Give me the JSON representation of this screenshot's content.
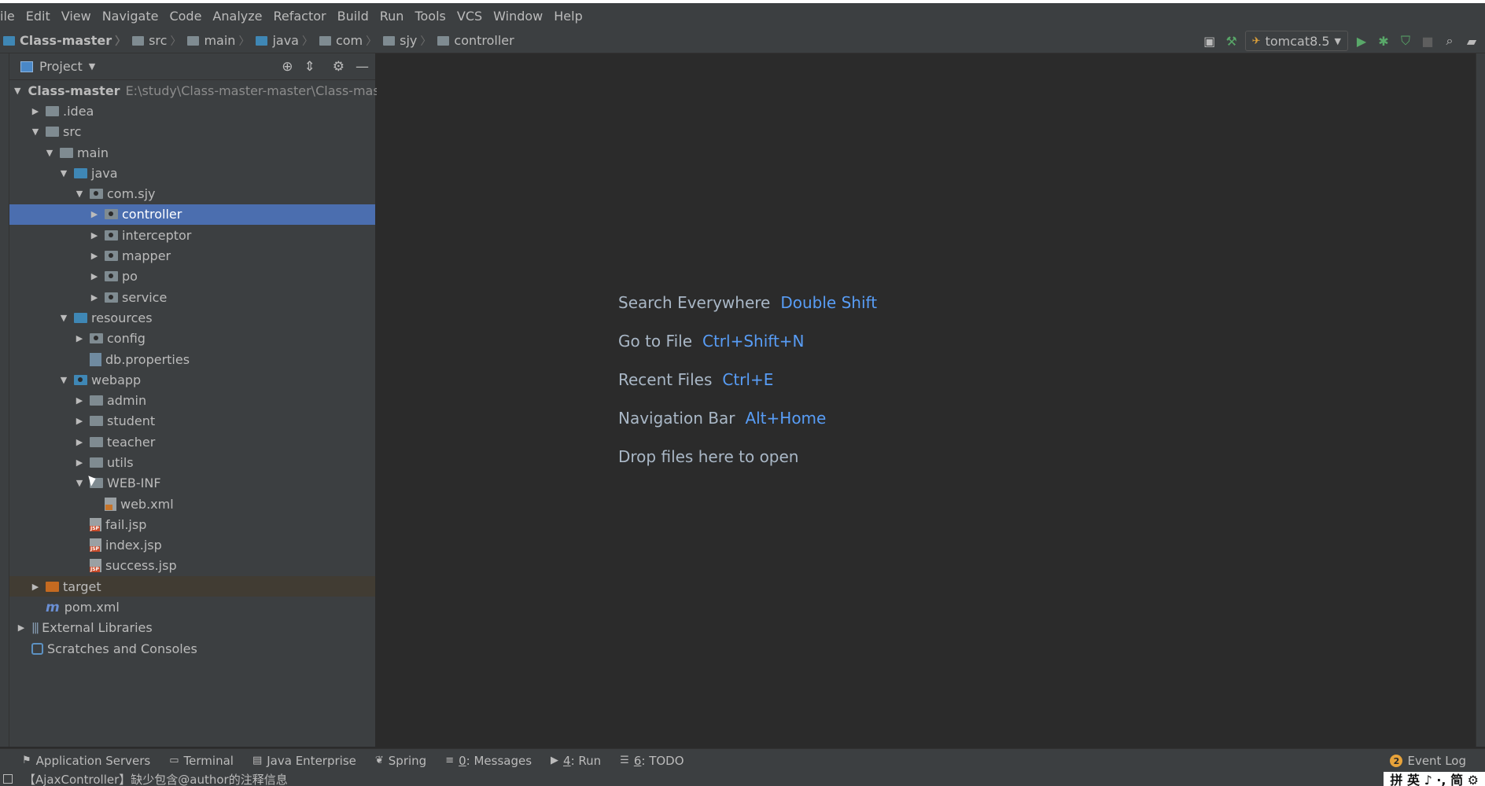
{
  "menu": [
    "ile",
    "Edit",
    "View",
    "Navigate",
    "Code",
    "Analyze",
    "Refactor",
    "Build",
    "Run",
    "Tools",
    "VCS",
    "Window",
    "Help"
  ],
  "breadcrumb": [
    "Class-master",
    "src",
    "main",
    "java",
    "com",
    "sjy",
    "controller"
  ],
  "toolbar": {
    "run_config": "tomcat8.5"
  },
  "project_panel": {
    "title": "Project",
    "tree": [
      {
        "label": "Class-master",
        "path": "E:\\study\\Class-master-master\\Class-master",
        "arrow": "▼",
        "icon": "module-folder",
        "depth": 0
      },
      {
        "label": ".idea",
        "arrow": "▶",
        "icon": "folder",
        "depth": 1
      },
      {
        "label": "src",
        "arrow": "▼",
        "icon": "folder",
        "depth": 1
      },
      {
        "label": "main",
        "arrow": "▼",
        "icon": "folder",
        "depth": 2
      },
      {
        "label": "java",
        "arrow": "▼",
        "icon": "source-folder",
        "depth": 3
      },
      {
        "label": "com.sjy",
        "arrow": "▼",
        "icon": "package-folder",
        "depth": 4
      },
      {
        "label": "controller",
        "arrow": "▶",
        "icon": "package-folder",
        "depth": 5,
        "selected": true
      },
      {
        "label": "interceptor",
        "arrow": "▶",
        "icon": "package-folder",
        "depth": 5
      },
      {
        "label": "mapper",
        "arrow": "▶",
        "icon": "package-folder",
        "depth": 5
      },
      {
        "label": "po",
        "arrow": "▶",
        "icon": "package-folder",
        "depth": 5
      },
      {
        "label": "service",
        "arrow": "▶",
        "icon": "package-folder",
        "depth": 5
      },
      {
        "label": "resources",
        "arrow": "▼",
        "icon": "resources-folder",
        "depth": 3
      },
      {
        "label": "config",
        "arrow": "▶",
        "icon": "package-folder",
        "depth": 4
      },
      {
        "label": "db.properties",
        "arrow": "",
        "icon": "properties-file",
        "depth": 4
      },
      {
        "label": "webapp",
        "arrow": "▼",
        "icon": "web-folder",
        "depth": 3
      },
      {
        "label": "admin",
        "arrow": "▶",
        "icon": "folder",
        "depth": 4
      },
      {
        "label": "student",
        "arrow": "▶",
        "icon": "folder",
        "depth": 4
      },
      {
        "label": "teacher",
        "arrow": "▶",
        "icon": "folder",
        "depth": 4
      },
      {
        "label": "utils",
        "arrow": "▶",
        "icon": "folder",
        "depth": 4
      },
      {
        "label": "WEB-INF",
        "arrow": "▼",
        "icon": "folder",
        "depth": 4
      },
      {
        "label": "web.xml",
        "arrow": "",
        "icon": "xml-file",
        "depth": 5
      },
      {
        "label": "fail.jsp",
        "arrow": "",
        "icon": "jsp-file",
        "depth": 4
      },
      {
        "label": "index.jsp",
        "arrow": "",
        "icon": "jsp-file",
        "depth": 4
      },
      {
        "label": "success.jsp",
        "arrow": "",
        "icon": "jsp-file",
        "depth": 4
      },
      {
        "label": "target",
        "arrow": "▶",
        "icon": "excluded-folder",
        "depth": 1,
        "excluded": true
      },
      {
        "label": "pom.xml",
        "arrow": "",
        "icon": "maven-icon",
        "depth": 1
      },
      {
        "label": "External Libraries",
        "arrow": "▶",
        "icon": "libraries-icon",
        "depth": 0
      },
      {
        "label": "Scratches and Consoles",
        "arrow": "",
        "icon": "scratches-icon",
        "depth": 0
      }
    ]
  },
  "editor_hints": [
    {
      "label": "Search Everywhere",
      "key": "Double Shift"
    },
    {
      "label": "Go to File",
      "key": "Ctrl+Shift+N"
    },
    {
      "label": "Recent Files",
      "key": "Ctrl+E"
    },
    {
      "label": "Navigation Bar",
      "key": "Alt+Home"
    },
    {
      "label": "Drop files here to open",
      "key": ""
    }
  ],
  "bottom_tools": [
    {
      "label": "Application Servers",
      "prefix": ""
    },
    {
      "label": "Terminal",
      "prefix": ""
    },
    {
      "label": "Java Enterprise",
      "prefix": ""
    },
    {
      "label": "Spring",
      "prefix": ""
    },
    {
      "label": ": Messages",
      "prefix": "0"
    },
    {
      "label": ": Run",
      "prefix": "4"
    },
    {
      "label": ": TODO",
      "prefix": "6"
    }
  ],
  "event_log": {
    "label": "Event Log",
    "count": "2"
  },
  "status": {
    "message": "【AjaxController】缺少包含@author的注释信息",
    "ime": "拼 英 ♪ ·, 简 ⚙"
  }
}
